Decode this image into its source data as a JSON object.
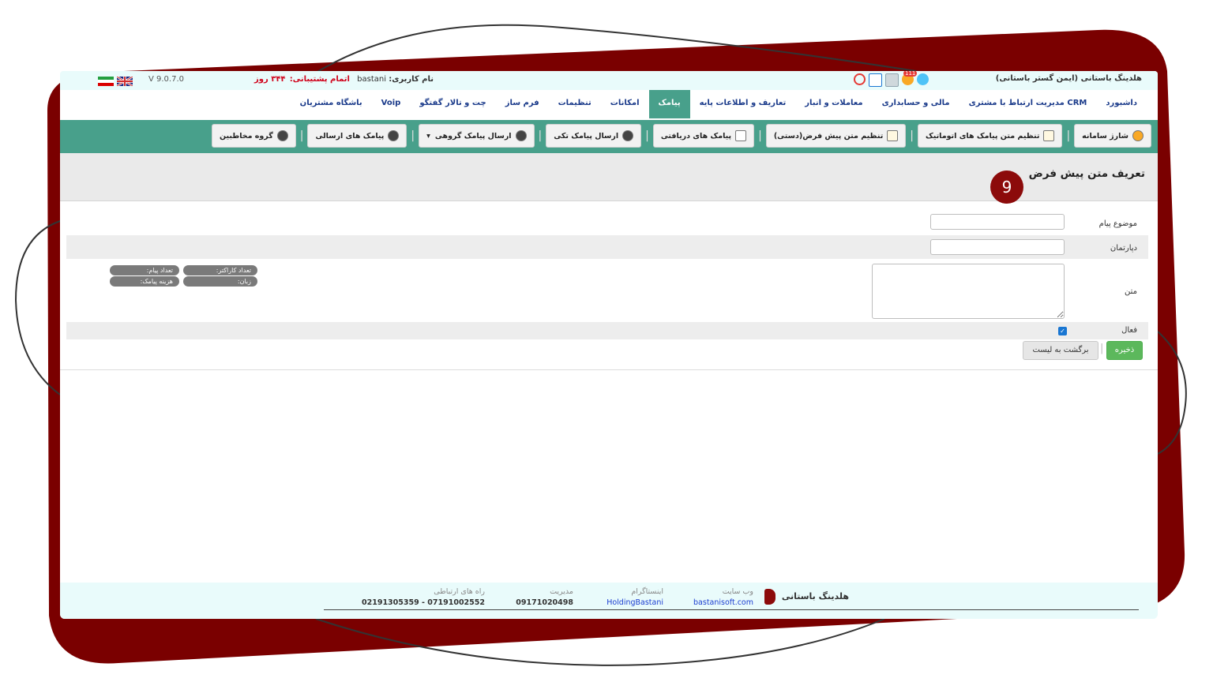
{
  "topbar": {
    "company": "هلدینگ باستانی (ایمن گستر باستانی)",
    "username_label": "نام کاربری:",
    "username": "bastani",
    "subscription_label": "اتمام پشتیبانی:",
    "subscription_value": "۳۴۴ روز",
    "version": "V 9.0.7.0",
    "notification_count": "111",
    "icons": [
      "chat-icon",
      "notification-bell-icon",
      "calendar-icon",
      "task-check-icon",
      "power-icon"
    ],
    "flags": [
      "uk-flag-icon",
      "iran-flag-icon"
    ]
  },
  "menu": {
    "items": [
      {
        "label": "داشبورد",
        "active": false
      },
      {
        "label": "مدیریت ارتباط با مشتری CRM",
        "active": false
      },
      {
        "label": "مالی و حسابداری",
        "active": false
      },
      {
        "label": "معاملات و انبار",
        "active": false
      },
      {
        "label": "تعاریف و اطلاعات پایه",
        "active": false
      },
      {
        "label": "پیامک",
        "active": true
      },
      {
        "label": "امکانات",
        "active": false
      },
      {
        "label": "تنظیمات",
        "active": false
      },
      {
        "label": "فرم ساز",
        "active": false
      },
      {
        "label": "چت و تالار گفتگو",
        "active": false
      },
      {
        "label": "Voip",
        "active": false
      },
      {
        "label": "باشگاه مشتریان",
        "active": false
      }
    ]
  },
  "toolbar": {
    "buttons": [
      {
        "label": "شارژ سامانه",
        "icon": "coin-icon"
      },
      {
        "label": "تنظیم متن پیامک های اتوماتیک",
        "icon": "document-icon"
      },
      {
        "label": "تنظیم متن پیش فرض(دستی)",
        "icon": "document-icon"
      },
      {
        "label": "پیامک های دریافتی",
        "icon": "inbox-icon"
      },
      {
        "label": "ارسال پیامک تکی",
        "icon": "user-icon"
      },
      {
        "label": "ارسال پیامک گروهی",
        "icon": "users-icon",
        "dropdown": true
      },
      {
        "label": "پیامک های ارسالی",
        "icon": "user-icon"
      },
      {
        "label": "گروه مخاطبین",
        "icon": "user-icon"
      }
    ]
  },
  "page": {
    "title": "تعریف متن پیش فرض",
    "step_badge": "9"
  },
  "form": {
    "subject_label": "موضوع پیام",
    "subject_value": "",
    "department_label": "دپارتمان",
    "department_value": "",
    "text_label": "متن",
    "text_value": "",
    "active_label": "فعال",
    "active_checked": true,
    "counters": {
      "char_count": "تعداد کاراکتر:",
      "msg_count": "تعداد پیام:",
      "language": "زبان:",
      "cost": "هزینه پیامک:"
    },
    "save_label": "ذخیره",
    "back_label": "برگشت به لیست"
  },
  "footer": {
    "logo_text": "هلدینگ باستانی",
    "website_title": "وب سایت",
    "website_value": "bastanisoft.com",
    "instagram_title": "اینستاگرام",
    "instagram_value": "HoldingBastani",
    "management_title": "مدیریت",
    "management_value": "09171020498",
    "contact_title": "راه های ارتباطی",
    "contact_value": "07191002552 - 02191305359"
  },
  "colors": {
    "toolbar_green": "#48a08b",
    "frame_maroon": "#7a0000",
    "menu_text": "#1a3a8a",
    "save_green": "#5cb85c",
    "badge_maroon": "#8c0b0b"
  }
}
